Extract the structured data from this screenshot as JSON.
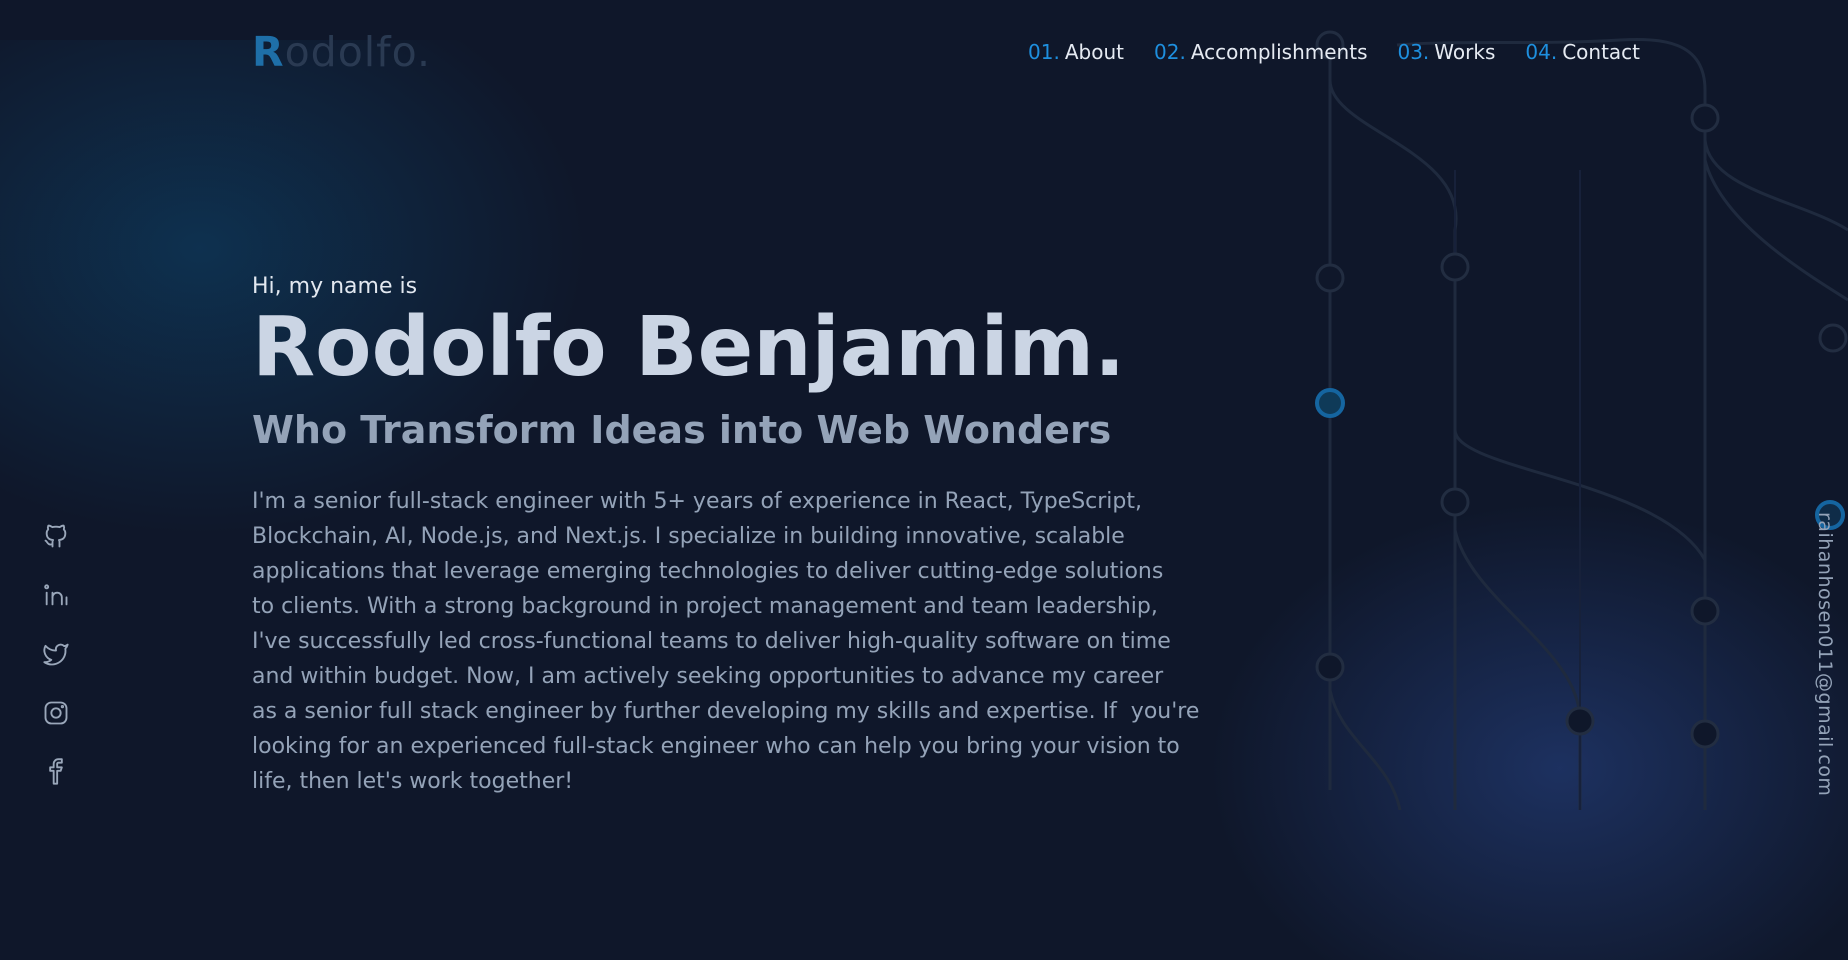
{
  "header": {
    "logo_first": "R",
    "logo_rest": "odolfo."
  },
  "nav": {
    "items": [
      {
        "num": "01.",
        "label": "About"
      },
      {
        "num": "02.",
        "label": "Accomplishments"
      },
      {
        "num": "03.",
        "label": "Works"
      },
      {
        "num": "04.",
        "label": "Contact"
      }
    ]
  },
  "hero": {
    "greeting": "Hi, my name is",
    "name": "Rodolfo Benjamim.",
    "tagline": "Who Transform Ideas into Web Wonders",
    "bio": "I'm a senior full-stack engineer with 5+ years of experience in React, TypeScript,\nBlockchain, AI, Node.js, and Next.js. I specialize in building innovative, scalable\napplications that leverage emerging technologies to deliver cutting-edge solutions\nto clients. With a strong background in project management and team leadership,\nI've successfully led cross-functional teams to deliver high-quality software on time\nand within budget. Now, I am actively seeking opportunities to advance my career\nas a senior full stack engineer by further developing my skills and expertise. If  you're\nlooking for an experienced full-stack engineer who can help you bring your vision to\nlife, then let's work together!"
  },
  "socials": [
    "github-icon",
    "linkedin-icon",
    "twitter-icon",
    "instagram-icon",
    "facebook-icon"
  ],
  "contact": {
    "email": "raihanhosen011@gmail.com"
  },
  "colors": {
    "background": "#0f172a",
    "accent": "#1e8fde",
    "heading": "#cbd5e4",
    "muted": "#94a3b8"
  }
}
